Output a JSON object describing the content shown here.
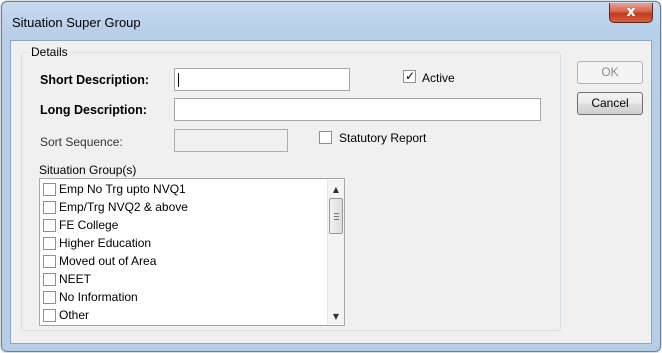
{
  "window": {
    "title": "Situation Super Group",
    "close_glyph": "x"
  },
  "details": {
    "legend": "Details",
    "short_description": {
      "label": "Short Description:",
      "value": ""
    },
    "long_description": {
      "label": "Long Description:",
      "value": ""
    },
    "sort_sequence": {
      "label": "Sort Sequence:",
      "value": ""
    },
    "active": {
      "label": "Active",
      "checked": true
    },
    "statutory_report": {
      "label": "Statutory Report",
      "checked": false
    },
    "situation_groups": {
      "label": "Situation Group(s)",
      "items": [
        {
          "label": "Emp No Trg upto NVQ1",
          "checked": false
        },
        {
          "label": "Emp/Trg NVQ2 & above",
          "checked": false
        },
        {
          "label": "FE College",
          "checked": false
        },
        {
          "label": "Higher Education",
          "checked": false
        },
        {
          "label": "Moved out of Area",
          "checked": false
        },
        {
          "label": "NEET",
          "checked": false
        },
        {
          "label": "No Information",
          "checked": false
        },
        {
          "label": "Other",
          "checked": false
        }
      ]
    }
  },
  "buttons": {
    "ok": "OK",
    "cancel": "Cancel"
  },
  "icons": {
    "checkmark": "checkmark-icon",
    "close": "close-icon",
    "scroll_up": "scroll-up-arrow-icon",
    "scroll_down": "scroll-down-arrow-icon"
  },
  "colors": {
    "title_bar": "#b9d1ea",
    "close_button": "#c7462b",
    "client_bg": "#f0f0f0"
  }
}
